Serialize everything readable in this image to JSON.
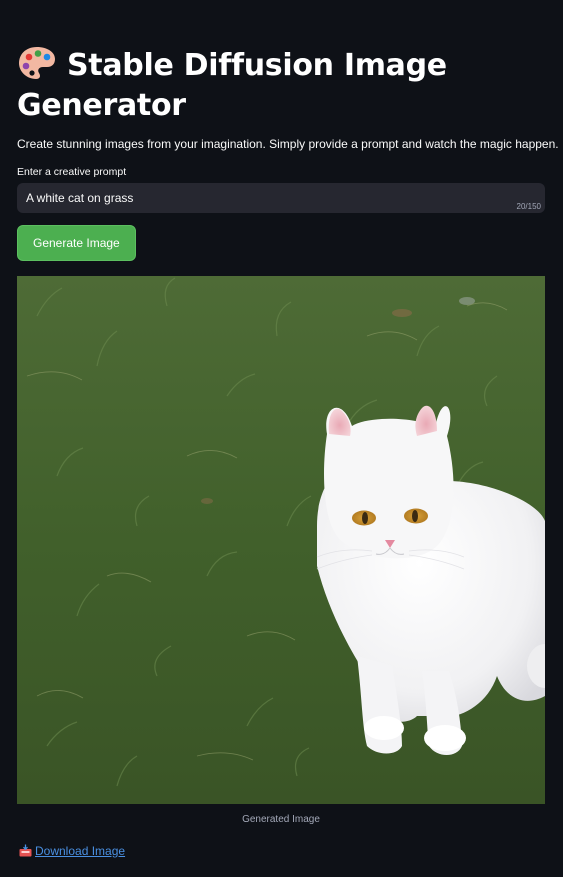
{
  "header": {
    "title": "Stable Diffusion Image Generator",
    "icon": "artist-palette-icon"
  },
  "intro": {
    "subtitle": "Create stunning images from your imagination. Simply provide a prompt and watch the magic happen."
  },
  "prompt": {
    "label": "Enter a creative prompt",
    "value": "A white cat on grass",
    "char_count": "20/150"
  },
  "actions": {
    "generate_label": "Generate Image",
    "download_label": "Download Image",
    "download_icon": "inbox-tray-icon"
  },
  "result": {
    "caption": "Generated Image",
    "image_description_icon": "generated-image"
  },
  "colors": {
    "background": "#0e1117",
    "button": "#4caf50",
    "input_bg": "#262730",
    "link": "#4a90e2"
  }
}
